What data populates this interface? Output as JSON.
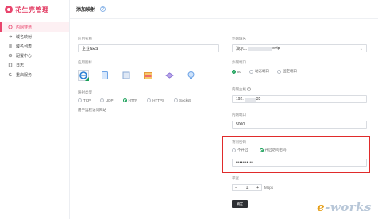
{
  "brand": {
    "title": "花生壳管理"
  },
  "sidebar": {
    "items": [
      {
        "label": "内网穿透",
        "icon": "link-icon",
        "active": true
      },
      {
        "label": "域名映射",
        "icon": "arrow-icon"
      },
      {
        "label": "域名列表",
        "icon": "list-icon"
      },
      {
        "label": "配置中心",
        "icon": "gear-icon"
      },
      {
        "label": "日志",
        "icon": "log-icon"
      },
      {
        "label": "重启服务",
        "icon": "reload-icon"
      }
    ]
  },
  "page": {
    "title": "添加映射",
    "help": "?"
  },
  "form": {
    "app_name_label": "应用名称",
    "app_name_value": "企业NAS",
    "app_icon_label": "应用图标",
    "app_icons": [
      "ie-icon",
      "tablet-icon",
      "server-icon",
      "gallery-icon",
      "hdd-icon",
      "camera-icon"
    ],
    "protocol_label": "映射类型",
    "protocols": [
      "TCP",
      "UDP",
      "HTTP",
      "HTTPS",
      "Socks5"
    ],
    "protocol_selected": "HTTP",
    "protocol_note": "用于远程访问网站",
    "domain_label": "外网域名",
    "domain_value": "演示...",
    "domain_suffix": "ovip",
    "port_label": "外网端口",
    "port_options": [
      "80",
      "动态端口",
      "固定端口"
    ],
    "port_selected": "80",
    "internal_ip_label": "内网主机",
    "internal_ip_value": "192.",
    "internal_ip_suffix": "35",
    "internal_port_label": "内网端口",
    "internal_port_value": "5000",
    "access_label": "访问密码",
    "access_options": [
      "不开启",
      "开启访问密码"
    ],
    "access_selected": "开启访问密码",
    "password_value": "••••••••••",
    "bandwidth_label": "带宽",
    "bandwidth_value": "1",
    "bandwidth_unit": "Mbps",
    "save_label": "确定"
  },
  "watermark": {
    "text_e": "e",
    "text_rest": "-works"
  },
  "colors": {
    "accent": "#e9456d",
    "green": "#18a058",
    "highlight": "#e02b2b"
  }
}
